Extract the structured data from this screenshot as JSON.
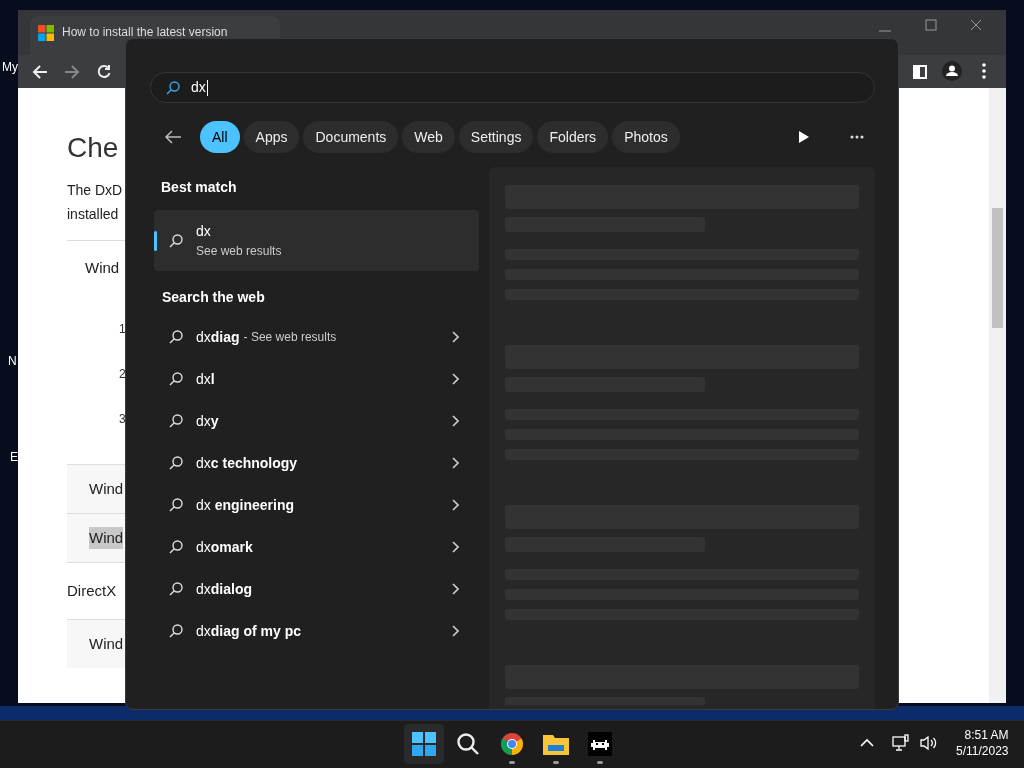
{
  "desktop_icons": [
    {
      "label": "My"
    },
    {
      "label": "N"
    },
    {
      "label": "E"
    }
  ],
  "browser": {
    "tab_title": "How to install the latest version",
    "page": {
      "heading": "Che",
      "paragraph_lines": [
        "The DxD",
        "installed"
      ],
      "blocks": [
        {
          "kind": "row",
          "text": "Wind"
        },
        {
          "kind": "step",
          "text": "1"
        },
        {
          "kind": "step",
          "text": "2"
        },
        {
          "kind": "step",
          "text": "3"
        },
        {
          "kind": "boxed",
          "text": "Wind",
          "highlighted": false
        },
        {
          "kind": "boxed",
          "text": "Wind",
          "highlighted": true
        },
        {
          "kind": "para",
          "text": "DirectX"
        },
        {
          "kind": "boxed",
          "text": "Wind",
          "highlighted": false
        }
      ]
    }
  },
  "search": {
    "query": "dx",
    "filters": [
      {
        "label": "All",
        "selected": true
      },
      {
        "label": "Apps",
        "selected": false
      },
      {
        "label": "Documents",
        "selected": false
      },
      {
        "label": "Web",
        "selected": false
      },
      {
        "label": "Settings",
        "selected": false
      },
      {
        "label": "Folders",
        "selected": false
      },
      {
        "label": "Photos",
        "selected": false
      }
    ],
    "best_match": {
      "heading": "Best match",
      "title": "dx",
      "subtitle": "See web results",
      "selected": true
    },
    "web": {
      "heading": "Search the web",
      "items": [
        {
          "text": "dx**diag**",
          "note": "- See web results"
        },
        {
          "text": "dx**l**"
        },
        {
          "text": "dx**y**"
        },
        {
          "text": "dx**c technology**"
        },
        {
          "text": "dx **engineering**"
        },
        {
          "text": "dx**omark**"
        },
        {
          "text": "dx**dialog**"
        },
        {
          "text": "dx**diag of my pc**"
        }
      ]
    }
  },
  "taskbar": {
    "apps": [
      {
        "kind": "start",
        "running": false
      },
      {
        "kind": "search",
        "running": false
      },
      {
        "kind": "chrome",
        "running": true
      },
      {
        "kind": "folder",
        "running": true
      },
      {
        "kind": "game",
        "running": true
      }
    ],
    "time": "8:51 AM",
    "date": "5/11/2023"
  }
}
